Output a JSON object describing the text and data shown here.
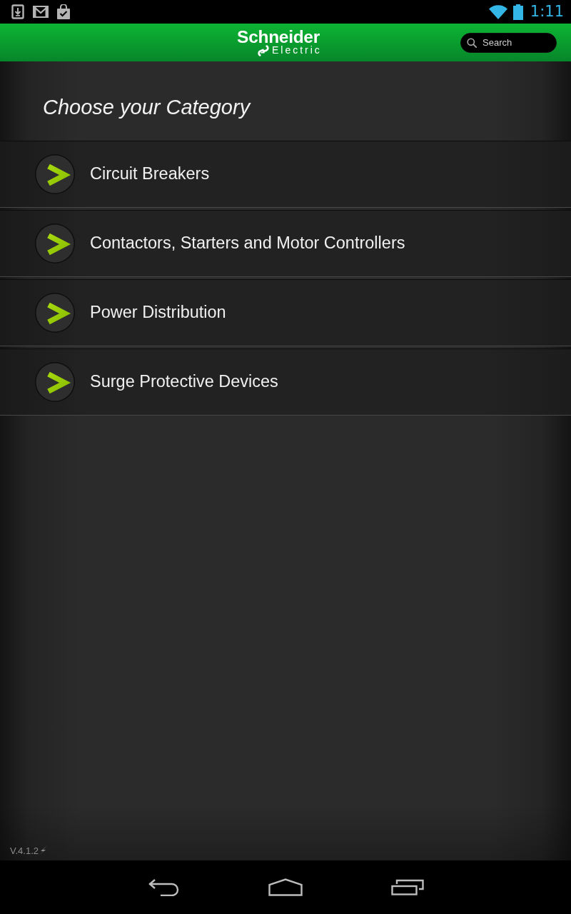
{
  "status_bar": {
    "time": "1:11"
  },
  "app_bar": {
    "logo": {
      "line_1": "Schneider",
      "line_2": "Electric"
    },
    "search": {
      "placeholder": "Search"
    }
  },
  "heading": "Choose your Category",
  "categories": [
    {
      "label": "Circuit Breakers"
    },
    {
      "label": "Contactors, Starters and Motor Controllers"
    },
    {
      "label": "Power Distribution"
    },
    {
      "label": "Surge Protective Devices"
    }
  ],
  "footer": {
    "version": "V.4.1.2"
  }
}
